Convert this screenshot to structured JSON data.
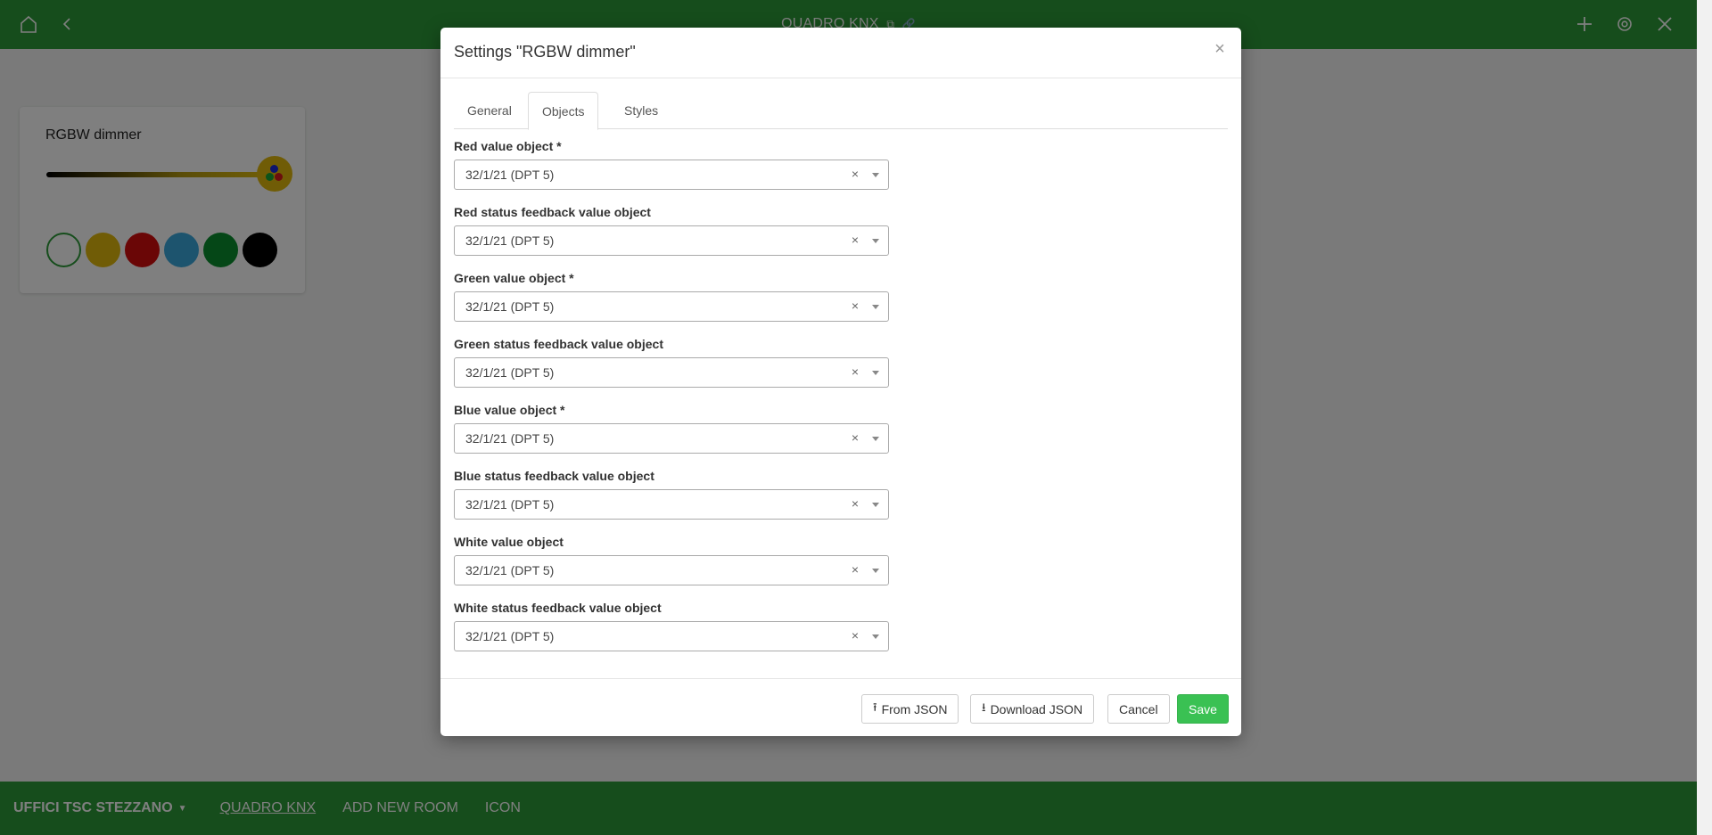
{
  "header": {
    "title": "QUADRO KNX",
    "home_icon": "home-icon",
    "back_icon": "chevron-left-icon",
    "add_icon": "plus-icon",
    "settings_icon": "gear-icon",
    "close_icon": "close-icon"
  },
  "widget": {
    "title": "RGBW dimmer",
    "swatches": [
      "#ffffff",
      "#e0b80c",
      "#d50d0d",
      "#3aa8dc",
      "#0a8f2e",
      "#000000"
    ]
  },
  "footer": {
    "items": [
      "UFFICI TSC STEZZANO",
      "QUADRO KNX",
      "ADD NEW ROOM",
      "ICON"
    ]
  },
  "colors": {
    "brand_green": "#2d9b38",
    "save_green": "#3ac153"
  },
  "modal": {
    "title": "Settings \"RGBW dimmer\"",
    "close_glyph": "×",
    "tabs": [
      "General",
      "Objects",
      "Styles"
    ],
    "active_tab": "Objects",
    "fields": [
      {
        "label": "Red value object *",
        "value": "32/1/21 (DPT 5)"
      },
      {
        "label": "Red status feedback value object",
        "value": "32/1/21 (DPT 5)"
      },
      {
        "label": "Green value object *",
        "value": "32/1/21 (DPT 5)"
      },
      {
        "label": "Green status feedback value object",
        "value": "32/1/21 (DPT 5)"
      },
      {
        "label": "Blue value object *",
        "value": "32/1/21 (DPT 5)"
      },
      {
        "label": "Blue status feedback value object",
        "value": "32/1/21 (DPT 5)"
      },
      {
        "label": "White value object",
        "value": "32/1/21 (DPT 5)"
      },
      {
        "label": "White status feedback value object",
        "value": "32/1/21 (DPT 5)"
      }
    ],
    "clear_glyph": "×",
    "buttons": {
      "from_json": "From JSON",
      "download_json": "Download JSON",
      "cancel": "Cancel",
      "save": "Save"
    }
  }
}
